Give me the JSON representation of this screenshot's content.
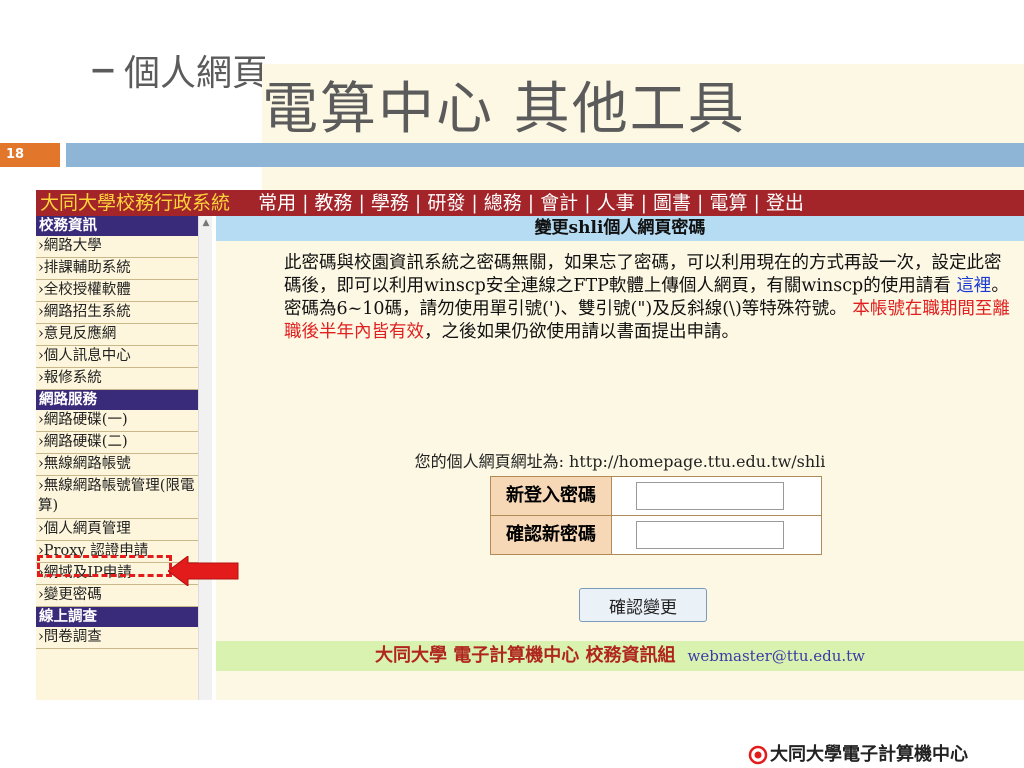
{
  "slide": {
    "title_main": "電算中心 其他工具",
    "title_sep": "–",
    "title_sub": "個人網頁",
    "page_number": "18",
    "logo_text": "大同大學電子計算機中心"
  },
  "topnav": {
    "brand": "大同大學校務行政系統",
    "menu": [
      "常用",
      "教務",
      "學務",
      "研發",
      "總務",
      "會計",
      "人事",
      "圖書",
      "電算",
      "登出"
    ],
    "divider": "|"
  },
  "sidebar": {
    "section1": "校務資訊",
    "items1": [
      "›網路大學",
      "›排課輔助系統",
      "›全校授權軟體",
      "›網路招生系統",
      "›意見反應網",
      "›個人訊息中心",
      "›報修系統"
    ],
    "section2": "網路服務",
    "items2": [
      "›網路硬碟(一)",
      "›網路硬碟(二)",
      "›無線網路帳號",
      "›無線網路帳號管理(限電算)",
      "›個人網頁管理",
      "›Proxy 認證申請",
      "›網域及IP申請",
      "›變更密碼"
    ],
    "section3": "線上調查",
    "items3": [
      "›問卷調查"
    ],
    "scroll_up": "▲"
  },
  "main": {
    "header": "變更shli個人網頁密碼",
    "para_1": "此密碼與校園資訊系統之密碼無關，如果忘了密碼，可以利用現在的方式再設一次，設定此密碼後，即可以利用winscp安全連線之FTP軟體上傳個人網頁，有關winscp的使用請看 ",
    "link_text": "這裡",
    "para_2": "。密碼為6~10碼，請勿使用單引號(')、雙引號(\")及反斜線(\\)等特殊符號。 ",
    "para_red": "本帳號在職期間至離職後半年內皆有效",
    "para_3": "，之後如果仍欲使用請以書面提出申請。",
    "url_line": "您的個人網頁網址為: http://homepage.ttu.edu.tw/shli",
    "new_password_label": "新登入密碼",
    "new_password_value": "",
    "confirm_password_label": "確認新密碼",
    "confirm_password_value": "",
    "submit_label": "確認變更",
    "footer_org": "大同大學 電子計算機中心 校務資訊組",
    "footer_email": "webmaster@ttu.edu.tw"
  },
  "colors": {
    "topnav_bg": "#a3252a",
    "brand": "#ffd43b",
    "header_bg": "#b6dcf3",
    "footer_bg": "#d9f2b0",
    "highlight": "#e31b1b"
  }
}
